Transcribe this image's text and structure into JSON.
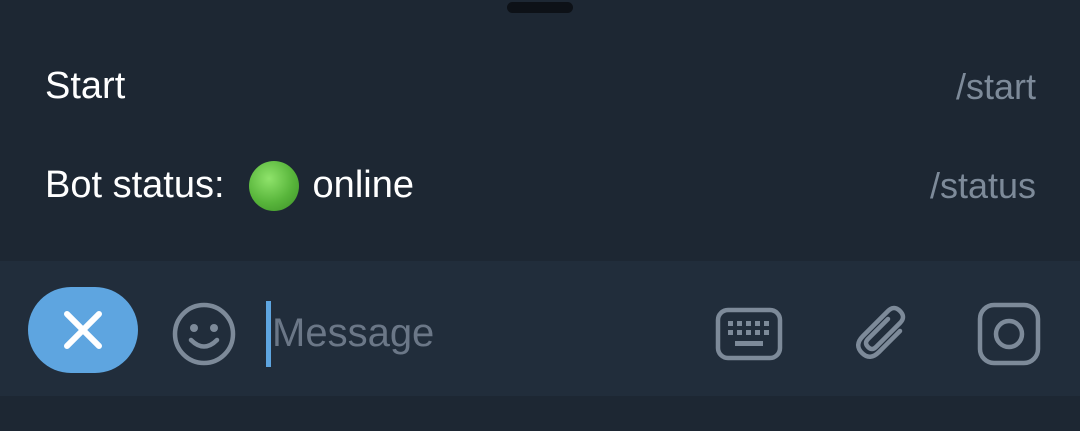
{
  "commands": [
    {
      "description": "Start",
      "command": "/start"
    },
    {
      "description": "Bot status:",
      "status_text": "online",
      "status_color": "#4caf50",
      "command": "/status"
    }
  ],
  "input_bar": {
    "placeholder": "Message",
    "value": ""
  },
  "icons": {
    "close": "close-icon",
    "emoji": "smiley-icon",
    "keyboard": "keyboard-icon",
    "attach": "paperclip-icon",
    "camera": "camera-icon"
  },
  "colors": {
    "background": "#1d2733",
    "input_bar": "#212d3b",
    "accent": "#5ea5e0",
    "secondary_text": "#7d8a99"
  }
}
